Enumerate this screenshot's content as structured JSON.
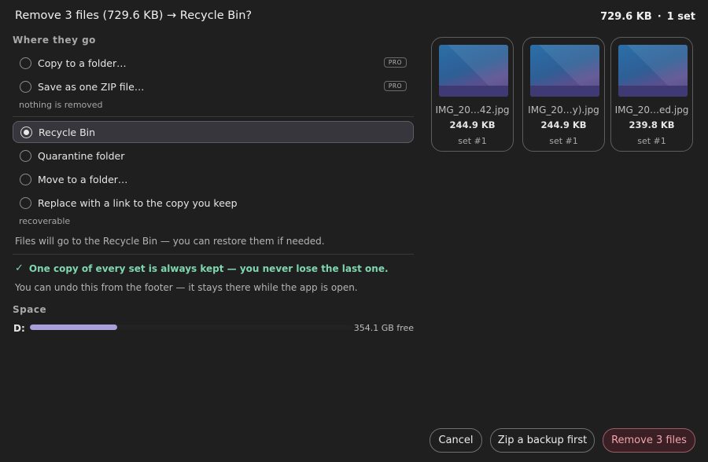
{
  "header": {
    "title": "Remove 3 files (729.6 KB) → Recycle Bin?",
    "total_size": "729.6 KB",
    "separator": "·",
    "set_count": "1 set"
  },
  "where": {
    "heading": "Where they go",
    "copy_options": [
      {
        "label": "Copy to a folder…",
        "badge": "PRO",
        "selected": false
      },
      {
        "label": "Save as one ZIP file…",
        "badge": "PRO",
        "selected": false
      }
    ],
    "copy_note": "nothing is removed",
    "remove_options": [
      {
        "label": "Recycle Bin",
        "selected": true
      },
      {
        "label": "Quarantine folder",
        "selected": false
      },
      {
        "label": "Move to a folder…",
        "selected": false
      },
      {
        "label": "Replace with a link to the copy you keep",
        "selected": false
      }
    ],
    "remove_note": "recoverable",
    "description": "Files will go to the Recycle Bin — you can restore them if needed."
  },
  "safety": {
    "check_icon": "✓",
    "text": "One copy of every set is always kept — you never lose the last one.",
    "undo_text": "You can undo this from the footer — it stays there while the app is open."
  },
  "space": {
    "heading": "Space",
    "drive": "D:",
    "used_fraction": 0.27,
    "free": "354.1 GB free"
  },
  "files": [
    {
      "name": "IMG_20…42.jpg",
      "size": "244.9 KB",
      "set": "set #1"
    },
    {
      "name": "IMG_20…y).jpg",
      "size": "244.9 KB",
      "set": "set #1"
    },
    {
      "name": "IMG_20…ed.jpg",
      "size": "239.8 KB",
      "set": "set #1"
    }
  ],
  "footer": {
    "cancel": "Cancel",
    "zip_backup": "Zip a backup first",
    "remove": "Remove 3 files"
  },
  "colors": {
    "accent_green": "#7fd6b0",
    "danger_text": "#f0a4ad",
    "bar_fill": "#a8a0d8"
  }
}
